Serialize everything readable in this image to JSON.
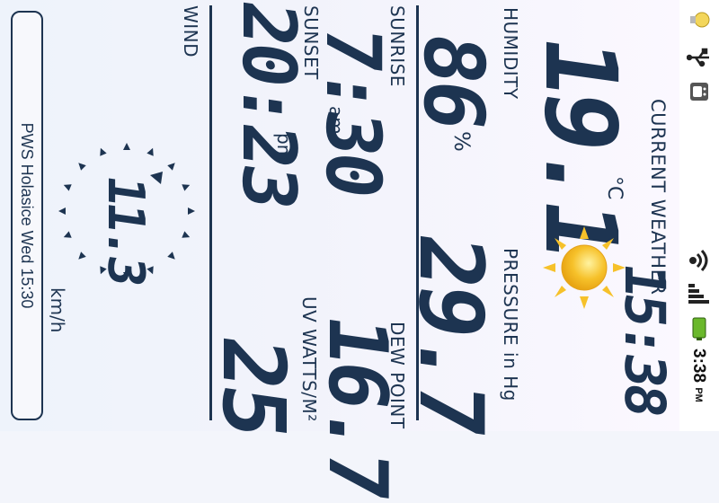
{
  "status_bar": {
    "time": "3:38",
    "ampm": "PM",
    "icons": [
      "lightbulb-icon",
      "usb-icon",
      "android-debug-icon",
      "wifi-icon",
      "signal-icon",
      "battery-icon"
    ],
    "battery_color": "#6ab82b"
  },
  "app": {
    "title": "CURRENT WEATHER",
    "time": "15:38",
    "temperature": {
      "value": "19.1",
      "unit": "°C"
    },
    "weather_icon": "sun-icon",
    "humidity": {
      "label": "HUMIDITY",
      "value": "86",
      "unit": "%"
    },
    "pressure": {
      "label": "PRESSURE  in Hg",
      "value": "29.7"
    },
    "sunrise": {
      "label": "SUNRISE",
      "value": "7:30",
      "unit": "am"
    },
    "sunset": {
      "label": "SUNSET",
      "value": "20:23",
      "unit": "pm"
    },
    "dew_point": {
      "label": "DEW POINT",
      "value": "16.7"
    },
    "uv": {
      "label": "UV WATTS/M²",
      "value": "25"
    },
    "wind": {
      "label": "WIND",
      "value": "11.3",
      "unit": "km/h",
      "direction_icon": "wind-direction-arrow-icon"
    },
    "footer": "PWS Holasice Wed 15:30",
    "accent_color": "#1d3451",
    "sun_color": "#f6c12a"
  }
}
